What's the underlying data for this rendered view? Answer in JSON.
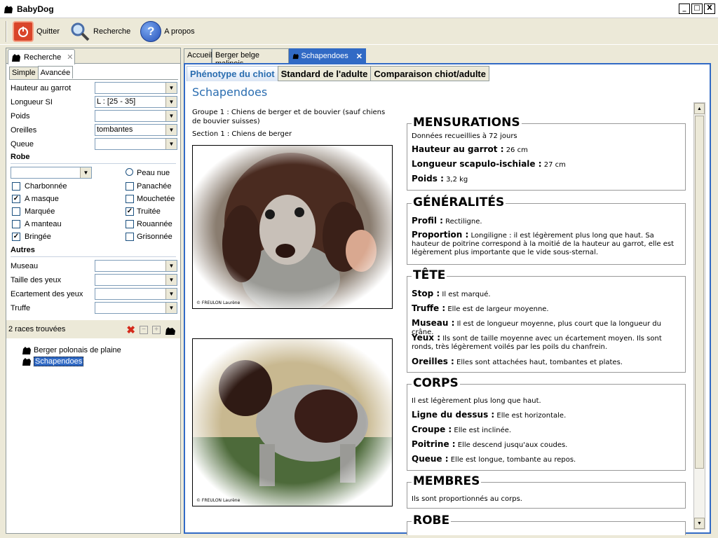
{
  "window": {
    "title": "BabyDog",
    "buttons": [
      "_",
      "□",
      "X"
    ]
  },
  "toolbar": {
    "quit": "Quitter",
    "search": "Recherche",
    "about": "A propos"
  },
  "left": {
    "tab": "Recherche",
    "subtabs": [
      "Simple",
      "Avancée"
    ],
    "fields": [
      {
        "label": "Hauteur au garrot",
        "value": ""
      },
      {
        "label": "Longueur SI",
        "value": "L : [25 - 35]"
      },
      {
        "label": "Poids",
        "value": ""
      },
      {
        "label": "Oreilles",
        "value": "tombantes"
      },
      {
        "label": "Queue",
        "value": ""
      }
    ],
    "robe_title": "Robe",
    "robe_radio": "Peau nue",
    "robe_checks": [
      {
        "label": "Charbonnée",
        "checked": false
      },
      {
        "label": "Panachée",
        "checked": false
      },
      {
        "label": "A masque",
        "checked": true
      },
      {
        "label": "Mouchetée",
        "checked": false
      },
      {
        "label": "Marquée",
        "checked": false
      },
      {
        "label": "Truitée",
        "checked": true
      },
      {
        "label": "A manteau",
        "checked": false
      },
      {
        "label": "Rouannée",
        "checked": false
      },
      {
        "label": "Bringée",
        "checked": true
      },
      {
        "label": "Grisonnée",
        "checked": false
      }
    ],
    "autres_title": "Autres",
    "autres": [
      {
        "label": "Museau",
        "value": ""
      },
      {
        "label": "Taille des yeux",
        "value": ""
      },
      {
        "label": "Ecartement des yeux",
        "value": ""
      },
      {
        "label": "Truffe",
        "value": ""
      }
    ],
    "result_count": "2 races trouvées",
    "results": [
      "Berger polonais de plaine",
      "Schapendoes"
    ]
  },
  "tabs": [
    "Accueil",
    "Berger belge malinois",
    "Schapendoes"
  ],
  "subtabs": [
    "Phénotype du chiot",
    "Standard de l'adulte",
    "Comparaison chiot/adulte"
  ],
  "breed": {
    "name": "Schapendoes",
    "group": "Groupe 1 : Chiens de berger et de bouvier (sauf chiens de bouvier suisses)",
    "section": "Section 1 : Chiens de berger",
    "photo_credit_1": "© FREULON Laurène",
    "photo_credit_2": "© FREULON Laurène"
  },
  "sections": {
    "mensurations": {
      "title": "MENSURATIONS",
      "note": "Données recueillies à 72 jours",
      "rows": [
        [
          "Hauteur au garrot :",
          "26 cm"
        ],
        [
          "Longueur scapulo-ischiale :",
          "27 cm"
        ],
        [
          "Poids :",
          "3,2 kg"
        ]
      ]
    },
    "generalites": {
      "title": "GÉNÉRALITÉS",
      "rows": [
        [
          "Profil :",
          "Rectiligne."
        ],
        [
          "Proportion :",
          "Longiligne : il est légèrement plus long que haut. Sa hauteur de poitrine correspond à la moitié de la hauteur au garrot, elle est légèrement plus importante que le vide sous-sternal."
        ]
      ]
    },
    "tete": {
      "title": "TÊTE",
      "rows": [
        [
          "Stop :",
          "Il est marqué."
        ],
        [
          "Truffe :",
          "Elle est de largeur moyenne."
        ],
        [
          "Museau :",
          "Il est de longueur moyenne, plus court que la longueur du crâne."
        ],
        [
          "Yeux :",
          "Ils sont de taille moyenne avec un écartement moyen. Ils sont ronds, très légèrement voilés par les poils du chanfrein."
        ],
        [
          "Oreilles :",
          "Elles sont attachées haut, tombantes et plates."
        ]
      ]
    },
    "corps": {
      "title": "CORPS",
      "note": "Il est légèrement plus long que haut.",
      "rows": [
        [
          "Ligne du dessus :",
          "Elle est horizontale."
        ],
        [
          "Croupe :",
          "Elle est inclinée."
        ],
        [
          "Poitrine :",
          "Elle descend jusqu'aux coudes."
        ],
        [
          "Queue :",
          "Elle est longue, tombante au repos."
        ]
      ]
    },
    "membres": {
      "title": "MEMBRES",
      "note": "Ils sont proportionnés au corps."
    },
    "robe": {
      "title": "ROBE"
    }
  }
}
